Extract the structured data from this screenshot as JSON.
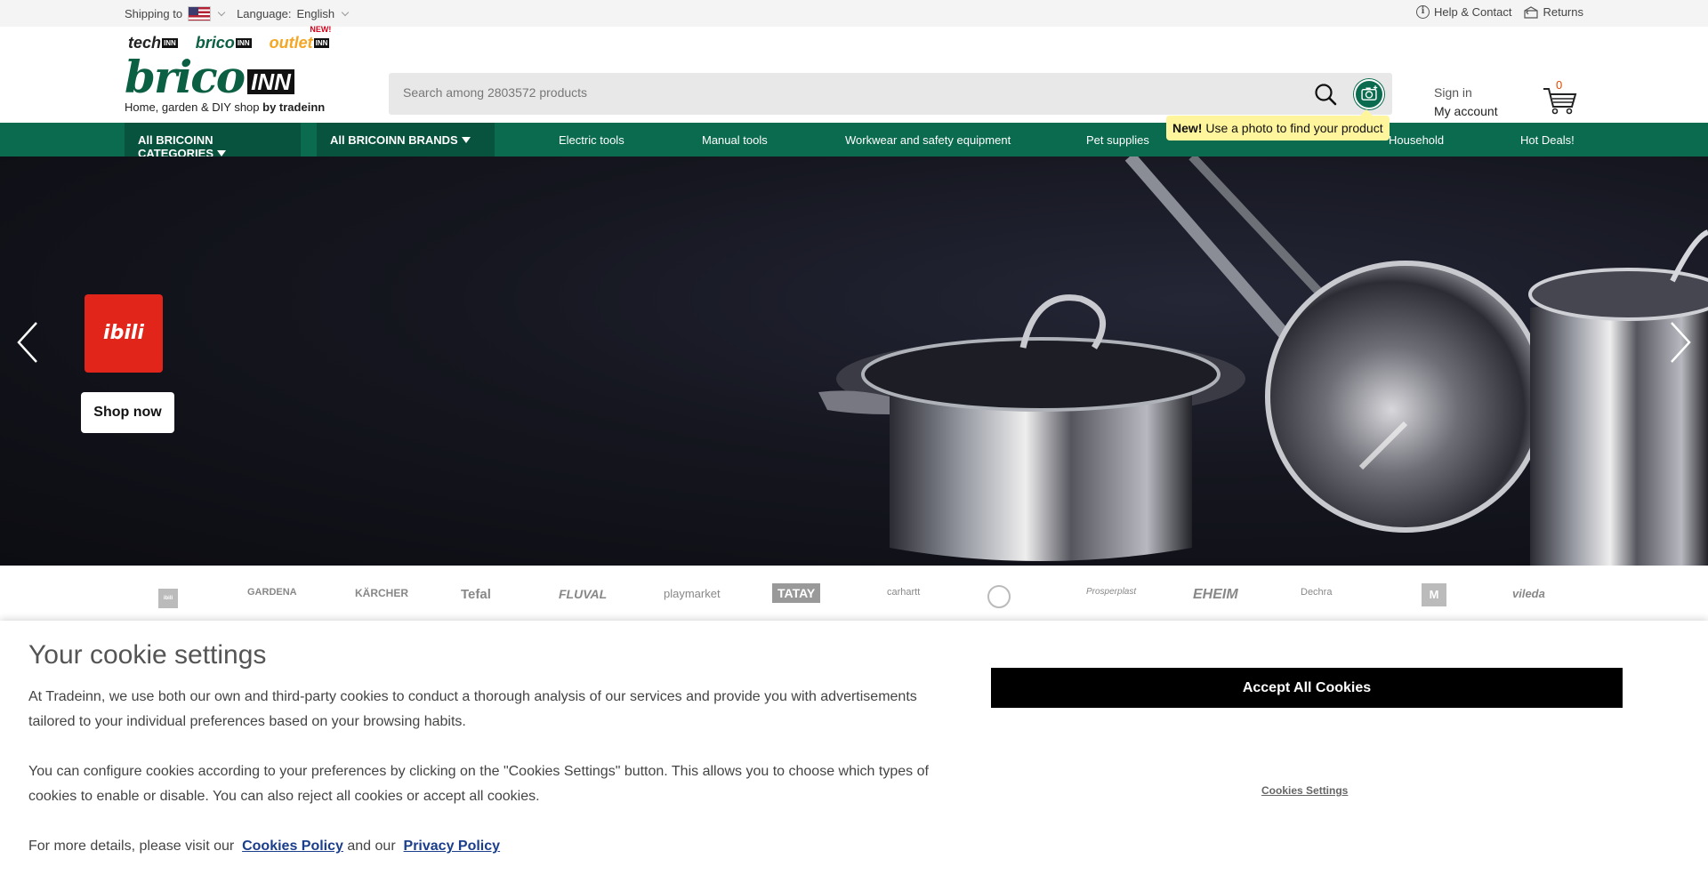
{
  "topbar": {
    "shipping_label": "Shipping to",
    "language_label": "Language:",
    "language_value": "English",
    "help_label": "Help & Contact",
    "returns_label": "Returns"
  },
  "site_logos": [
    {
      "name": "tech",
      "inn": "INN"
    },
    {
      "name": "brico",
      "inn": "INN"
    },
    {
      "name": "outlet",
      "inn": "INN",
      "badge": "NEW!"
    }
  ],
  "brand": {
    "logo_word": "brico",
    "logo_inn": "INN",
    "tagline": "Home, garden & DIY shop",
    "tagline_by": "by tradeinn"
  },
  "search": {
    "placeholder": "Search among 2803572 products"
  },
  "tooltip": {
    "new": "New!",
    "text": "Use a photo to find your product"
  },
  "account": {
    "sign_in": "Sign in",
    "my_account": "My account"
  },
  "cart": {
    "count": "0"
  },
  "nav": {
    "categories": "All BRICOINN CATEGORIES",
    "brands": "All BRICOINN BRANDS",
    "links": [
      "Electric tools",
      "Manual tools",
      "Workwear and safety equipment",
      "Pet supplies",
      "Household",
      "Hot Deals!"
    ]
  },
  "hero": {
    "brand_logo": "ibili",
    "cta": "Shop now"
  },
  "brand_strip": [
    "ibili",
    "GARDENA",
    "KÄRCHER",
    "Tefal",
    "FLUVAL",
    "playmarket",
    "TATAY",
    "carhartt",
    "",
    "Prosperplast",
    "EHEIM",
    "Dechra",
    "M",
    "vileda"
  ],
  "cookie": {
    "title": "Your cookie settings",
    "para1": "At Tradeinn, we use both our own and third-party cookies to conduct a thorough analysis of our services and provide you with advertisements tailored to your individual preferences based on your browsing habits.",
    "para2": "You can configure cookies according to your preferences by clicking on the \"Cookies Settings\" button. This allows you to choose which types of cookies to enable or disable. You can also reject all cookies or accept all cookies.",
    "para3_prefix": "For more details, please visit our",
    "cookies_policy": "Cookies Policy",
    "and_our": "and our",
    "privacy_policy": "Privacy Policy",
    "accept": "Accept All Cookies",
    "settings": "Cookies Settings"
  },
  "colors": {
    "brand_green": "#0b6b4f",
    "nav_dark": "#08533d",
    "tooltip_yellow": "#fff59d",
    "cart_count": "#e04a00"
  }
}
